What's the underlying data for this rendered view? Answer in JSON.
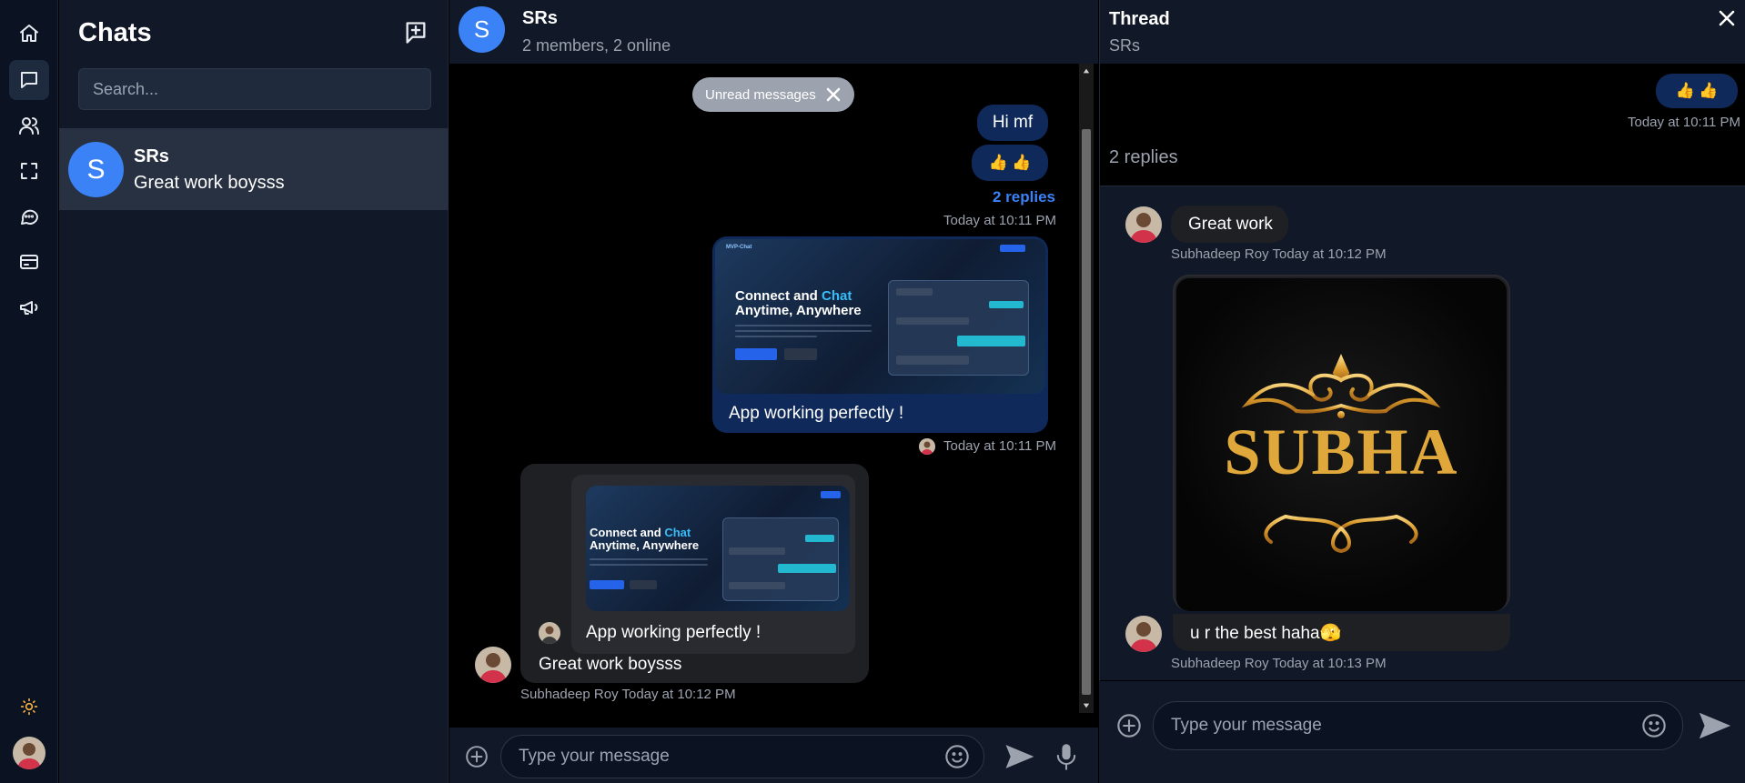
{
  "sidebar": {
    "icons": [
      "home-icon",
      "chat-icon",
      "users-icon",
      "scan-icon",
      "message-circle-icon",
      "card-icon",
      "megaphone-icon"
    ],
    "active": "chat-icon",
    "theme_icon": "sun-icon"
  },
  "chats_panel": {
    "title": "Chats",
    "search_placeholder": "Search...",
    "items": [
      {
        "avatar_letter": "S",
        "name": "SRs",
        "preview": "Great work boysss"
      }
    ]
  },
  "conversation": {
    "avatar_letter": "S",
    "title": "SRs",
    "subtitle": "2 members, 2 online",
    "unread_pill": "Unread messages",
    "messages": [
      {
        "text": "Hi mf"
      },
      {
        "text": "👍 👍",
        "replies": "2 replies",
        "time": "Today at 10:11 PM"
      },
      {
        "caption": "App working perfectly !",
        "time": "Today at 10:11 PM"
      },
      {
        "quoted_caption": "App working perfectly !",
        "text": "Great work boysss",
        "author_time": "Subhadeep Roy Today at 10:12 PM"
      }
    ],
    "preview": {
      "brand": "MVP-Chat",
      "headline_1": "Connect and ",
      "headline_accent": "Chat",
      "headline_2": "Anytime, Anywhere"
    },
    "composer_placeholder": "Type your message"
  },
  "thread": {
    "title": "Thread",
    "subtitle": "SRs",
    "parent_text": "👍 👍",
    "parent_time": "Today at 10:11 PM",
    "reply_count": "2 replies",
    "replies": [
      {
        "text": "Great work",
        "meta": "Subhadeep Roy Today at 10:12 PM"
      },
      {
        "image_text": "SUBHA",
        "text": "u r the best haha🫣",
        "meta": "Subhadeep Roy Today at 10:13 PM"
      }
    ],
    "composer_placeholder": "Type your message"
  },
  "colors": {
    "accent": "#3b82f6",
    "outgoing_bubble": "#0f2a5a",
    "incoming_bubble": "#1f2024",
    "panel": "#111827",
    "gold": "#e0a83a"
  }
}
